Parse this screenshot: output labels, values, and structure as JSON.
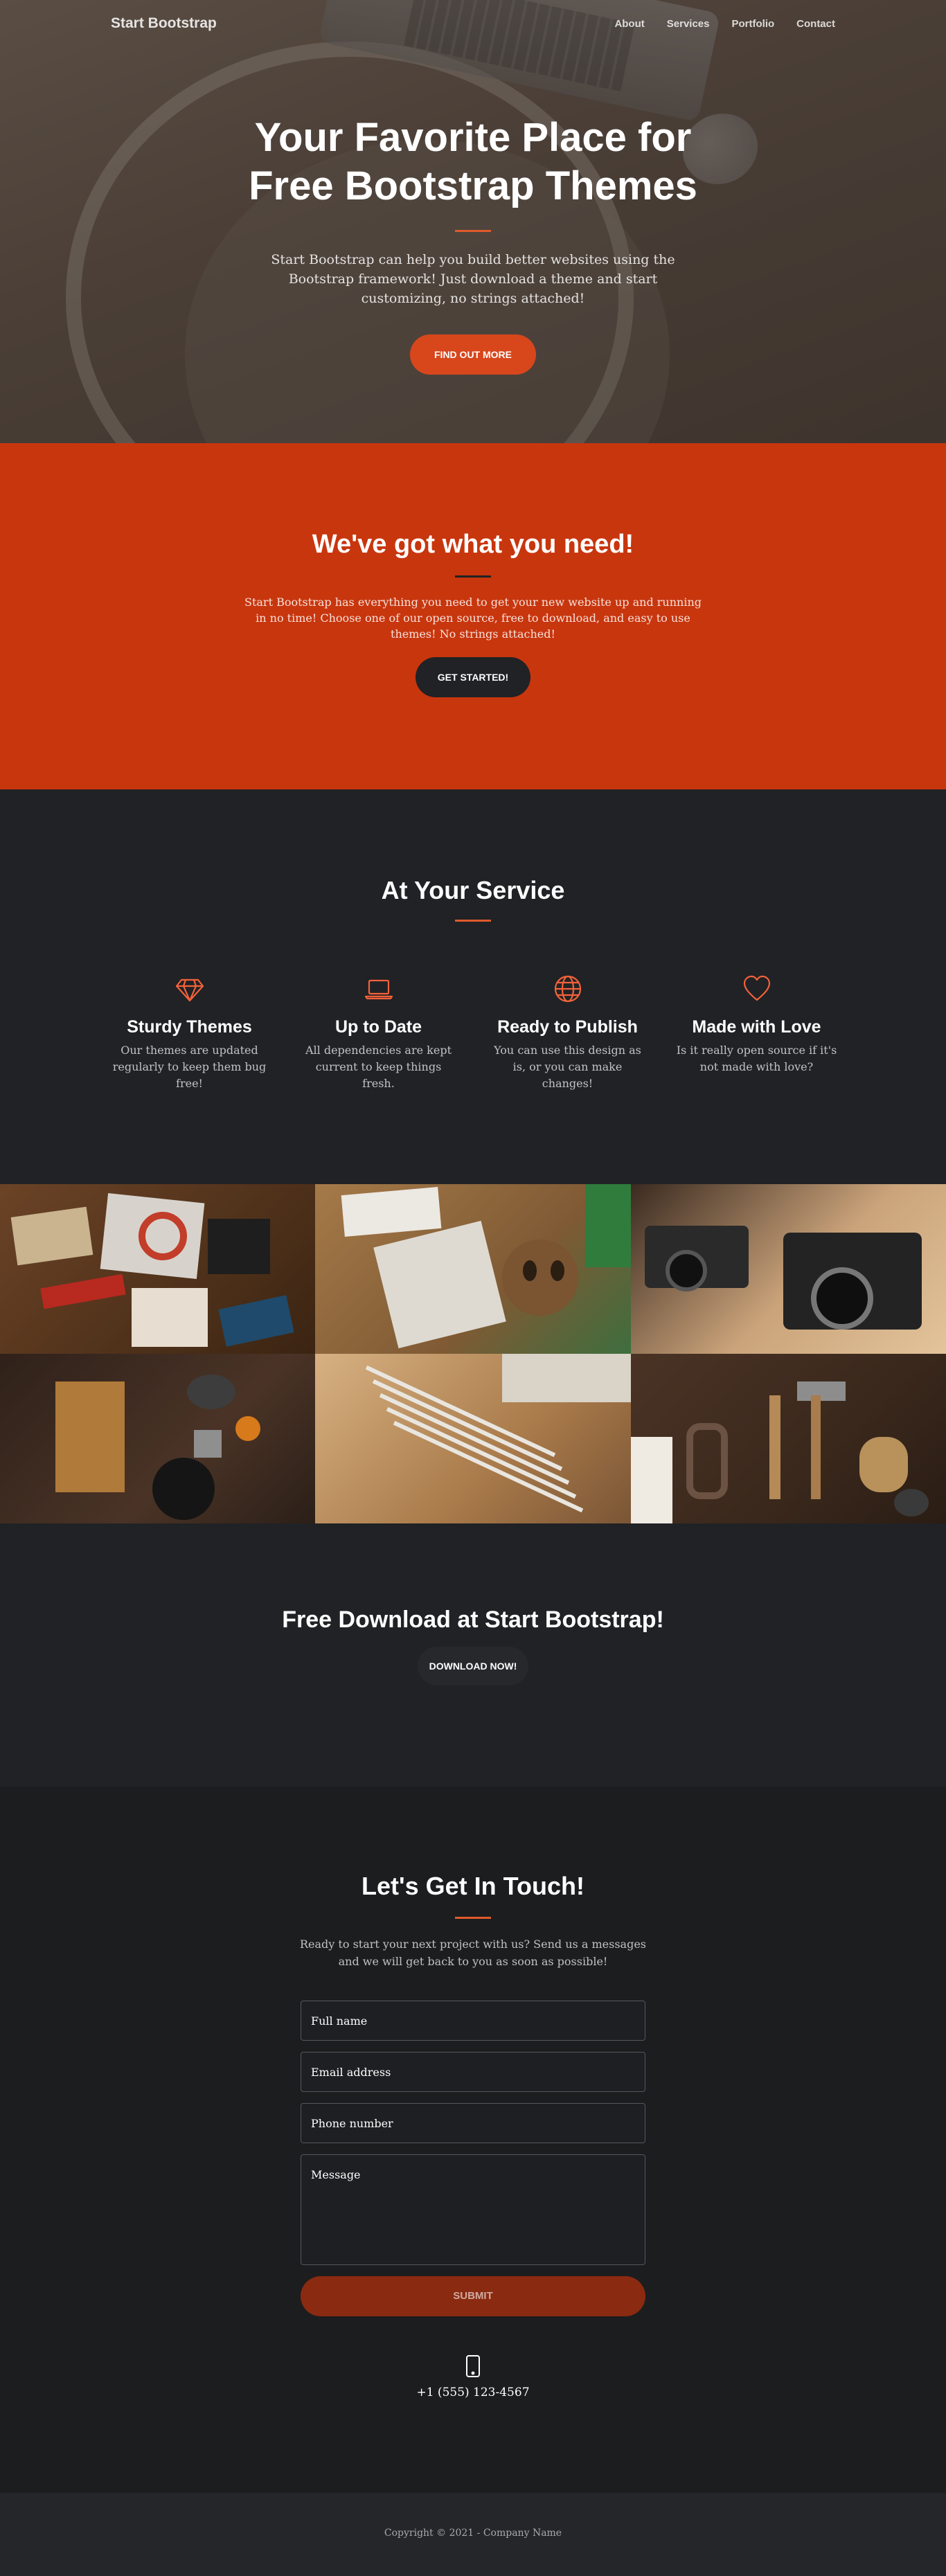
{
  "nav": {
    "brand": "Start Bootstrap",
    "links": [
      "About",
      "Services",
      "Portfolio",
      "Contact"
    ]
  },
  "hero": {
    "title": "Your Favorite Place for Free Bootstrap Themes",
    "subtitle": "Start Bootstrap can help you build better websites using the Bootstrap framework! Just download a theme and start customizing, no strings attached!",
    "button": "FIND OUT MORE"
  },
  "about": {
    "title": "We've got what you need!",
    "text": "Start Bootstrap has everything you need to get your new website up and running in no time! Choose one of our open source, free to download, and easy to use themes! No strings attached!",
    "button": "GET STARTED!"
  },
  "services": {
    "title": "At Your Service",
    "items": [
      {
        "icon": "gem-icon",
        "title": "Sturdy Themes",
        "text": "Our themes are updated regularly to keep them bug free!"
      },
      {
        "icon": "laptop-icon",
        "title": "Up to Date",
        "text": "All dependencies are kept current to keep things fresh."
      },
      {
        "icon": "globe-icon",
        "title": "Ready to Publish",
        "text": "You can use this design as is, or you can make changes!"
      },
      {
        "icon": "heart-icon",
        "title": "Made with Love",
        "text": "Is it really open source if it's not made with love?"
      }
    ]
  },
  "cta": {
    "title": "Free Download at Start Bootstrap!",
    "button": "DOWNLOAD NOW!"
  },
  "contact": {
    "title": "Let's Get In Touch!",
    "text": "Ready to start your next project with us? Send us a messages and we will get back to you as soon as possible!",
    "fields": {
      "name": "Full name",
      "email": "Email address",
      "phone": "Phone number",
      "message": "Message"
    },
    "submit": "SUBMIT",
    "phone": "+1 (555) 123-4567"
  },
  "footer": {
    "text": "Copyright © 2021 - Company Name"
  },
  "colors": {
    "primary": "#f4623a",
    "about_bg": "#c8360e",
    "dark_bg": "#202225"
  }
}
